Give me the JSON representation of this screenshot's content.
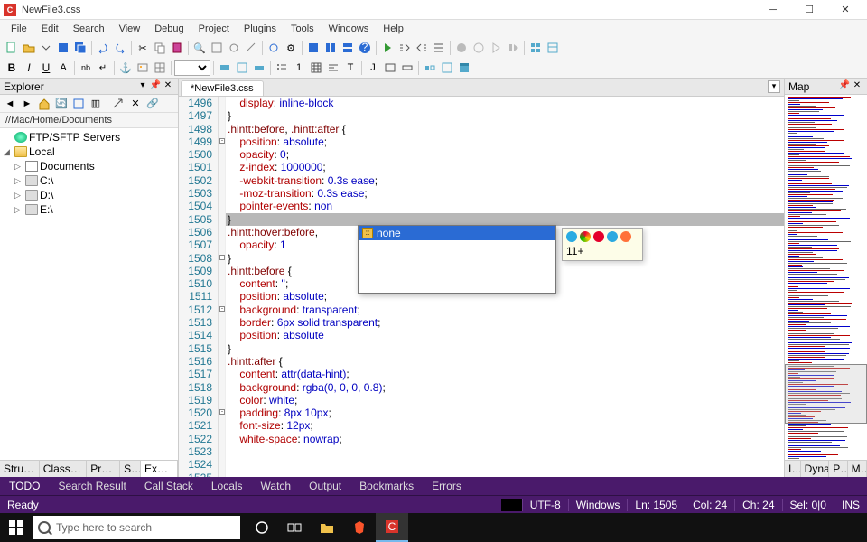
{
  "window": {
    "title": "NewFile3.css"
  },
  "menu": [
    "File",
    "Edit",
    "Search",
    "View",
    "Debug",
    "Project",
    "Plugins",
    "Tools",
    "Windows",
    "Help"
  ],
  "panels": {
    "explorer": {
      "title": "Explorer",
      "breadcrumb": "//Mac/Home/Documents"
    },
    "map": {
      "title": "Map"
    }
  },
  "explorer_tree": {
    "servers": "FTP/SFTP Servers",
    "local": "Local",
    "local_children": [
      {
        "label": "Documents",
        "type": "doc"
      },
      {
        "label": "C:\\",
        "type": "drive"
      },
      {
        "label": "D:\\",
        "type": "drive"
      },
      {
        "label": "E:\\",
        "type": "drive"
      }
    ]
  },
  "side_tabs": [
    "Structu…",
    "Class Vie…",
    "Proje…",
    "S…",
    "Explor…"
  ],
  "editor": {
    "tab": "*NewFile3.css",
    "first_line": 1496,
    "code": [
      [
        [
          "    ",
          ""
        ],
        [
          "display",
          1
        ],
        [
          ": ",
          0
        ],
        [
          "inline-block",
          2
        ]
      ],
      [
        [
          "}",
          3
        ]
      ],
      [],
      [
        [
          ".hintt:before",
          4
        ],
        [
          ", ",
          0
        ],
        [
          ".hintt:after",
          4
        ],
        [
          " {",
          3
        ]
      ],
      [
        [
          "    ",
          ""
        ],
        [
          "position",
          1
        ],
        [
          ": ",
          0
        ],
        [
          "absolute",
          2
        ],
        [
          ";",
          0
        ]
      ],
      [
        [
          "    ",
          ""
        ],
        [
          "opacity",
          1
        ],
        [
          ": ",
          0
        ],
        [
          "0",
          2
        ],
        [
          ";",
          0
        ]
      ],
      [
        [
          "    ",
          ""
        ],
        [
          "z-index",
          1
        ],
        [
          ": ",
          0
        ],
        [
          "1000000",
          2
        ],
        [
          ";",
          0
        ]
      ],
      [
        [
          "    ",
          ""
        ],
        [
          "-webkit-transition",
          1
        ],
        [
          ": ",
          0
        ],
        [
          "0.3s ease",
          2
        ],
        [
          ";",
          0
        ]
      ],
      [
        [
          "    ",
          ""
        ],
        [
          "-moz-transition",
          1
        ],
        [
          ": ",
          0
        ],
        [
          "0.3s ease",
          2
        ],
        [
          ";",
          0
        ]
      ],
      [
        [
          "    ",
          ""
        ],
        [
          "pointer-events",
          1
        ],
        [
          ": ",
          0
        ],
        [
          "non",
          2
        ]
      ],
      [
        [
          "}",
          3
        ]
      ],
      [],
      [
        [
          ".hintt:hover:before",
          4
        ],
        [
          ",",
          0
        ]
      ],
      [
        [
          "    ",
          ""
        ],
        [
          "opacity",
          1
        ],
        [
          ": ",
          0
        ],
        [
          "1",
          2
        ]
      ],
      [
        [
          "}",
          3
        ]
      ],
      [],
      [
        [
          ".hintt:before",
          4
        ],
        [
          " {",
          3
        ]
      ],
      [
        [
          "    ",
          ""
        ],
        [
          "content",
          1
        ],
        [
          ": ",
          0
        ],
        [
          "''",
          2
        ],
        [
          ";",
          0
        ]
      ],
      [
        [
          "    ",
          ""
        ],
        [
          "position",
          1
        ],
        [
          ": ",
          0
        ],
        [
          "absolute",
          2
        ],
        [
          ";",
          0
        ]
      ],
      [
        [
          "    ",
          ""
        ],
        [
          "background",
          1
        ],
        [
          ": ",
          0
        ],
        [
          "transparent",
          2
        ],
        [
          ";",
          0
        ]
      ],
      [
        [
          "    ",
          ""
        ],
        [
          "border",
          1
        ],
        [
          ": ",
          0
        ],
        [
          "6px solid transparent",
          2
        ],
        [
          ";",
          0
        ]
      ],
      [
        [
          "    ",
          ""
        ],
        [
          "position",
          1
        ],
        [
          ": ",
          0
        ],
        [
          "absolute",
          2
        ]
      ],
      [
        [
          "}",
          3
        ]
      ],
      [],
      [
        [
          ".hintt:after",
          4
        ],
        [
          " {",
          3
        ]
      ],
      [
        [
          "    ",
          ""
        ],
        [
          "content",
          1
        ],
        [
          ": ",
          0
        ],
        [
          "attr(data-hint)",
          2
        ],
        [
          ";",
          0
        ]
      ],
      [
        [
          "    ",
          ""
        ],
        [
          "background",
          1
        ],
        [
          ": ",
          0
        ],
        [
          "rgba(0, 0, 0, 0.8)",
          2
        ],
        [
          ";",
          0
        ]
      ],
      [
        [
          "    ",
          ""
        ],
        [
          "color",
          1
        ],
        [
          ": ",
          0
        ],
        [
          "white",
          2
        ],
        [
          ";",
          0
        ]
      ],
      [
        [
          "    ",
          ""
        ],
        [
          "padding",
          1
        ],
        [
          ": ",
          0
        ],
        [
          "8px 10px",
          2
        ],
        [
          ";",
          0
        ]
      ],
      [
        [
          "    ",
          ""
        ],
        [
          "font-size",
          1
        ],
        [
          ": ",
          0
        ],
        [
          "12px",
          2
        ],
        [
          ";",
          0
        ]
      ],
      [
        [
          "    ",
          ""
        ],
        [
          "white-space",
          1
        ],
        [
          ": ",
          0
        ],
        [
          "nowrap",
          2
        ],
        [
          ";",
          0
        ]
      ]
    ],
    "highlight_line_index": 9,
    "fold_rows": {
      "3": "-",
      "12": "-",
      "16": "-",
      "24": "-"
    }
  },
  "autocomplete": {
    "suggestion": "none",
    "browser_version": "11+"
  },
  "bottom_tabs": [
    "TODO",
    "Search Result",
    "Call Stack",
    "Locals",
    "Watch",
    "Output",
    "Bookmarks",
    "Errors"
  ],
  "status": {
    "ready": "Ready",
    "encoding": "UTF-8",
    "platform": "Windows",
    "line": "Ln: 1505",
    "col": "Col: 24",
    "ch": "Ch: 24",
    "sel": "Sel: 0|0",
    "ins": "INS"
  },
  "taskbar": {
    "search_placeholder": "Type here to search"
  },
  "map_tabs": [
    "I…",
    "Dyna…",
    "P…",
    "M…"
  ]
}
